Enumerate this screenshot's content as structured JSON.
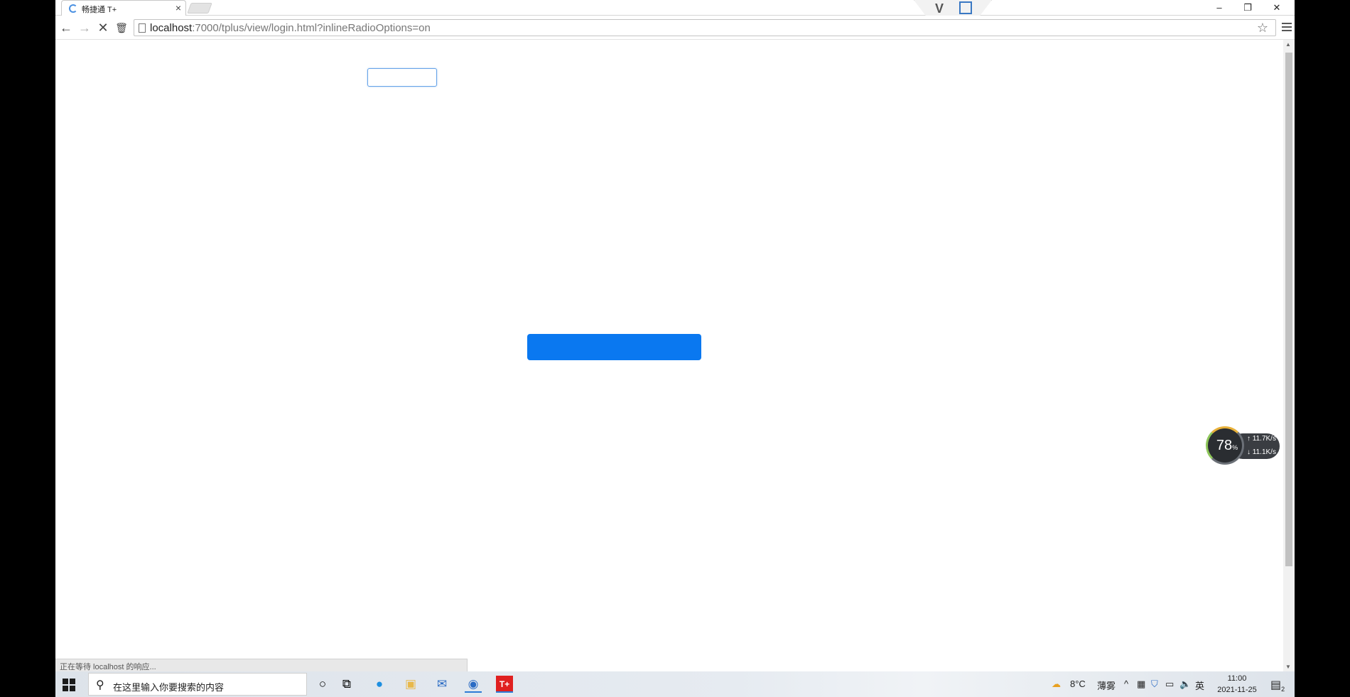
{
  "browser": {
    "tab_title": "畅捷通 T+",
    "tab_close": "×",
    "url_host": "localhost",
    "url_rest": ":7000/tplus/view/login.html?inlineRadioOptions=on",
    "status_text": "正在等待 localhost 的响应..."
  },
  "window_controls": {
    "minimize": "–",
    "restore": "❐",
    "close": "✕"
  },
  "page": {
    "input_value": "",
    "button_color": "#0a78f0"
  },
  "net_monitor": {
    "percent": "78",
    "percent_unit": "%",
    "up_speed": "↑ 11.7K/s",
    "down_speed": "↓ 11.1K/s"
  },
  "taskbar": {
    "search_placeholder": "在这里输入你要搜索的内容",
    "weather_temp": "8°C",
    "weather_desc": "薄雾",
    "ime": "英",
    "time": "11:00",
    "date": "2021-11-25",
    "notif_count": "2"
  }
}
